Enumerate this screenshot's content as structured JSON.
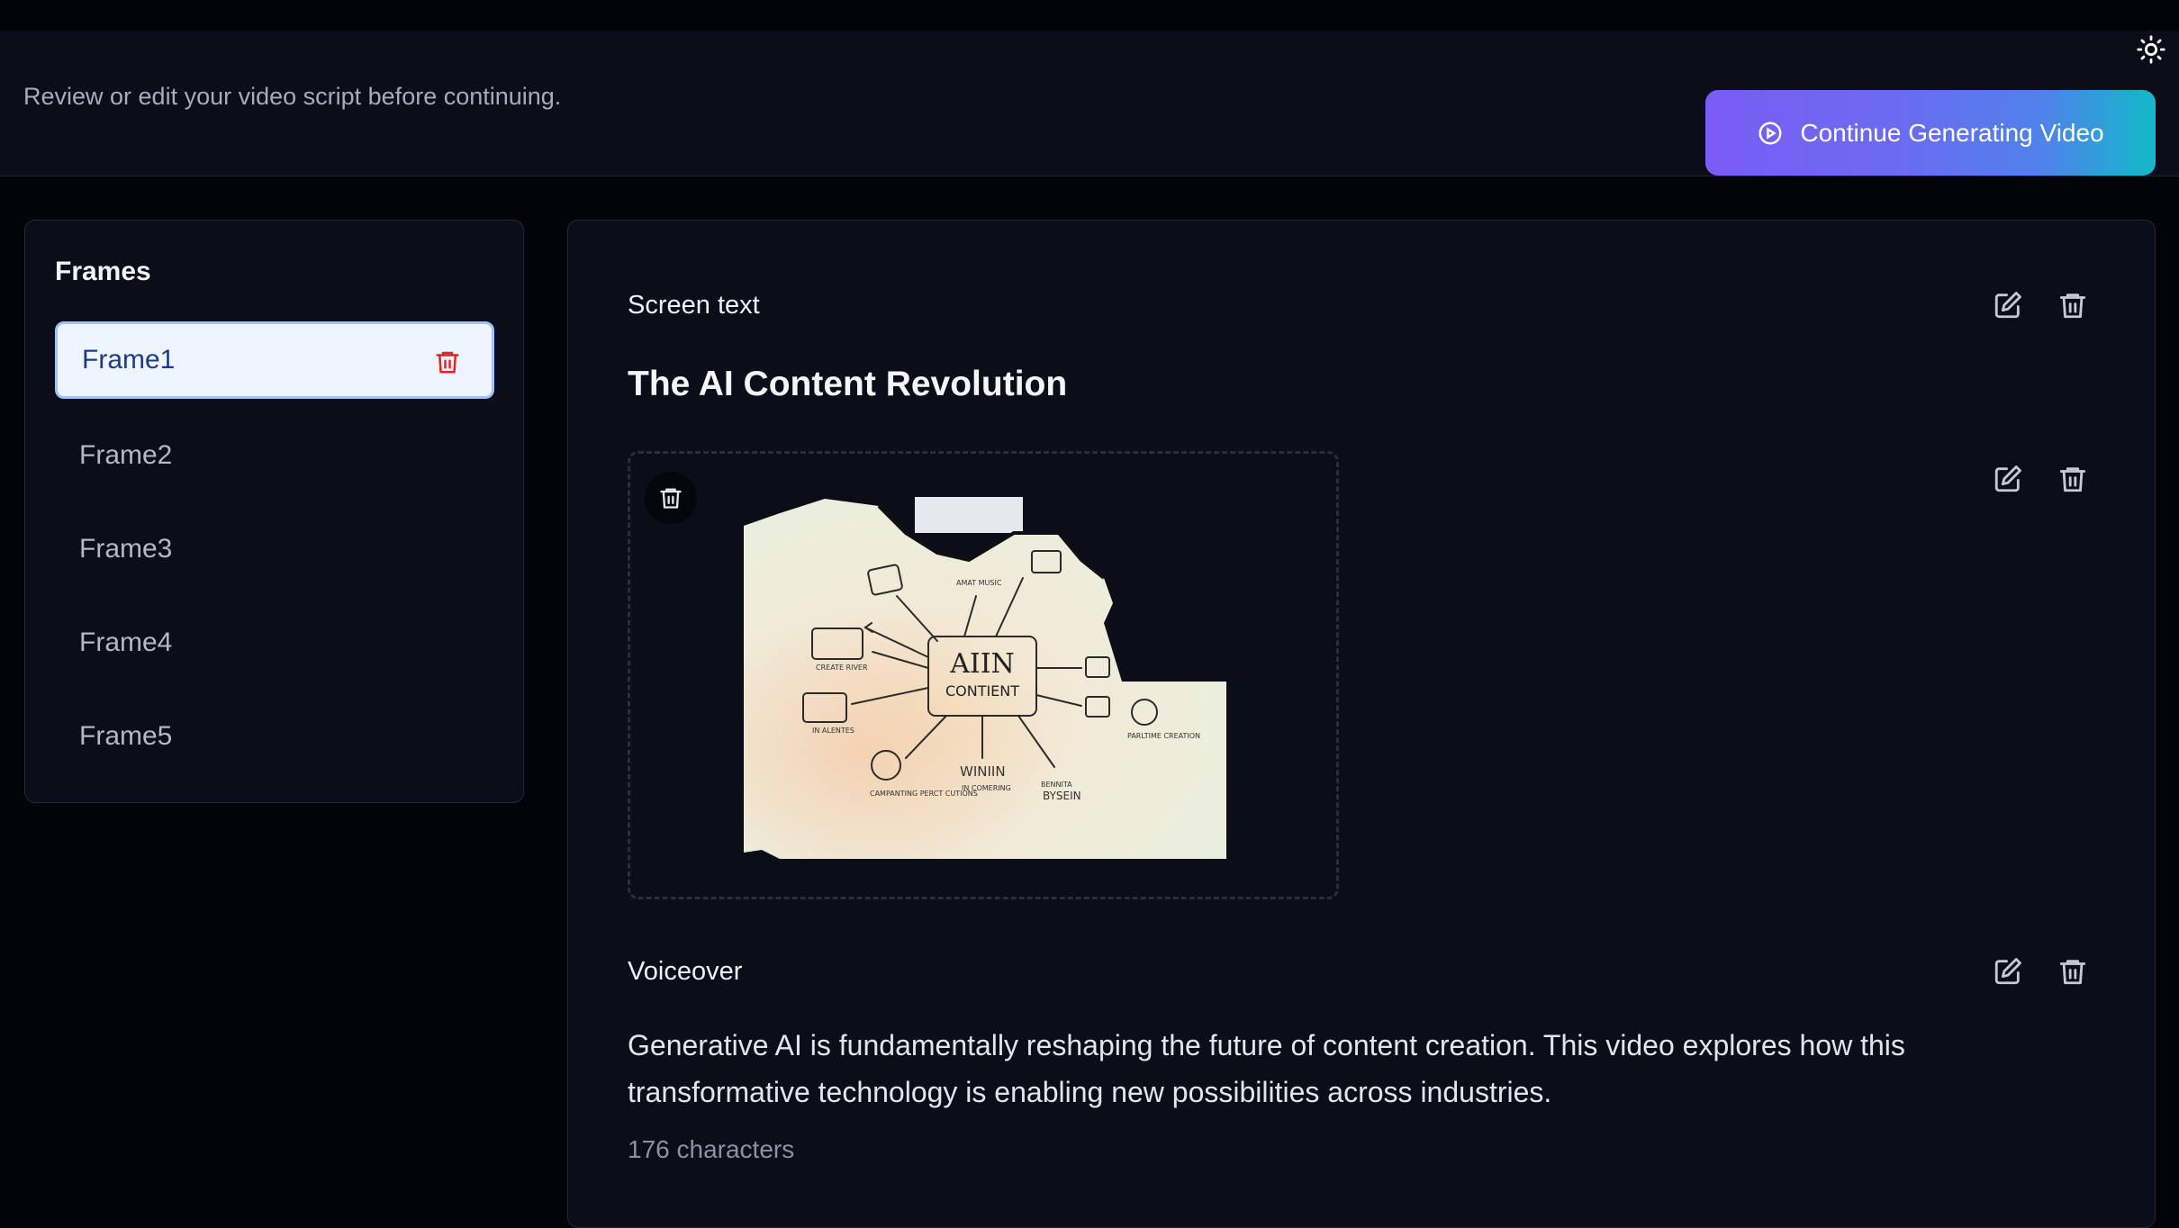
{
  "header": {
    "subtitle": "Review or edit your video script before continuing.",
    "continue_label": "Continue Generating Video",
    "theme_icon": "sun-icon"
  },
  "sidebar": {
    "title": "Frames",
    "items": [
      {
        "label": "Frame1",
        "active": true
      },
      {
        "label": "Frame2",
        "active": false
      },
      {
        "label": "Frame3",
        "active": false
      },
      {
        "label": "Frame4",
        "active": false
      },
      {
        "label": "Frame5",
        "active": false
      }
    ]
  },
  "main": {
    "screen_text_label": "Screen text",
    "screen_title": "The AI Content Revolution",
    "image": {
      "center_label_line1": "AIIN",
      "center_label_line2": "CONTIENT",
      "node_labels": [
        "CREATE RIVER",
        "IN ALENTES",
        "CAMPANTING PERCT CUTIONS",
        "WINIIN",
        "IN COMERING",
        "BENNITA",
        "BYSEIN",
        "PARLTIME CREATION",
        "AMAT MUSIC"
      ]
    },
    "voiceover_label": "Voiceover",
    "voiceover_text": "Generative AI is fundamentally reshaping the future of content creation. This video explores how this transformative technology is enabling new possibilities across industries.",
    "char_count": "176 characters"
  },
  "colors": {
    "background": "#030408",
    "panel": "#0b0d19",
    "active_frame_bg": "#eff5ff",
    "active_frame_text": "#1e3a8a",
    "delete_red": "#dc2626",
    "button_gradient_start": "#7b5cf5",
    "button_gradient_end": "#12b9c9"
  }
}
